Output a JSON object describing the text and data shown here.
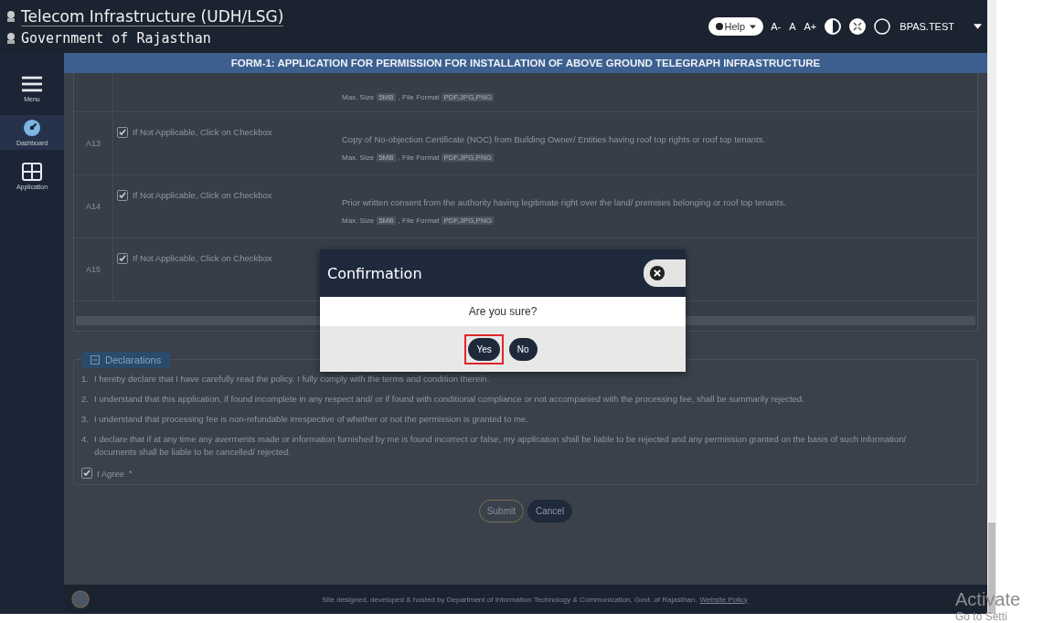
{
  "header": {
    "title": "Telecom Infrastructure (UDH/LSG)",
    "subtitle": "Government of Rajasthan",
    "help": "Help",
    "font_sizes": [
      "A-",
      "A",
      "A+"
    ],
    "user": "BPAS.TEST"
  },
  "form_title": "FORM-1: APPLICATION FOR PERMISSION FOR INSTALLATION OF ABOVE GROUND TELEGRAPH INFRASTRUCTURE",
  "sidebar": [
    {
      "label": "Menu",
      "kind": "menu",
      "selected": false
    },
    {
      "label": "Dashboard",
      "kind": "dashboard",
      "selected": true
    },
    {
      "label": "Application",
      "kind": "application",
      "selected": false
    }
  ],
  "documents": {
    "partial_note": {
      "size_label": "Max. Size",
      "size": "5MB",
      "format_label": ", File Format",
      "format": "PDF,JPG,PNG"
    },
    "rows": [
      {
        "code": "A13",
        "checked": true,
        "label": "If Not Applicable, Click on Checkbox",
        "description": "Copy of No-objection Certificate (NOC) from Building Owner/ Entities having roof top rights or roof top tenants.",
        "size_label": "Max. Size",
        "size": "5MB",
        "format_label": ", File Format",
        "format": "PDF,JPG,PNG"
      },
      {
        "code": "A14",
        "checked": true,
        "label": "If Not Applicable, Click on Checkbox",
        "description": "Prior written consent from the authority having legitimate right over the land/ premises belonging or roof top tenants.",
        "size_label": "Max. Size",
        "size": "5MB",
        "format_label": ", File Format",
        "format": "PDF,JPG,PNG"
      },
      {
        "code": "A15",
        "checked": true,
        "label": "If Not Applicable, Click on Checkbox"
      }
    ]
  },
  "declarations": {
    "title": "Declarations",
    "items": [
      {
        "number": "1.",
        "text": "I hereby declare that I have carefully read the policy. I fully comply with the terms and condition therein."
      },
      {
        "number": "2.",
        "text": "I understand that this application, if found incomplete in any respect and/ or if found with conditional compliance or not accompanied with the processing fee, shall be summarily rejected."
      },
      {
        "number": "3.",
        "text": "I understand that processing fee is non-refundable irrespective of whether or not the permission is granted to me."
      },
      {
        "number": "4.",
        "text": "I declare that if at any time any averments made or information furnished by me is found incorrect or false, my application shall be liable to be rejected and any permission granted on the basis of such information/ documents shall be liable to be cancelled/ rejected."
      }
    ],
    "agree": {
      "label": "I Agree",
      "required_mark": "*",
      "checked": true
    }
  },
  "actions": [
    {
      "label": "Submit",
      "kind": "outline"
    },
    {
      "label": "Cancel",
      "kind": "solid"
    }
  ],
  "footer": {
    "text": "Site designed, developed & hosted by Department of Information Technology & Communication, Govt. of Rajasthan,",
    "link": "Website Policy"
  },
  "modal": {
    "title": "Confirmation",
    "message": "Are you sure?",
    "buttons": [
      {
        "label": "Yes",
        "highlighted": true
      },
      {
        "label": "No",
        "highlighted": false
      }
    ]
  },
  "os_notice": {
    "line1": "Activate",
    "line2": "Go to Setti"
  }
}
